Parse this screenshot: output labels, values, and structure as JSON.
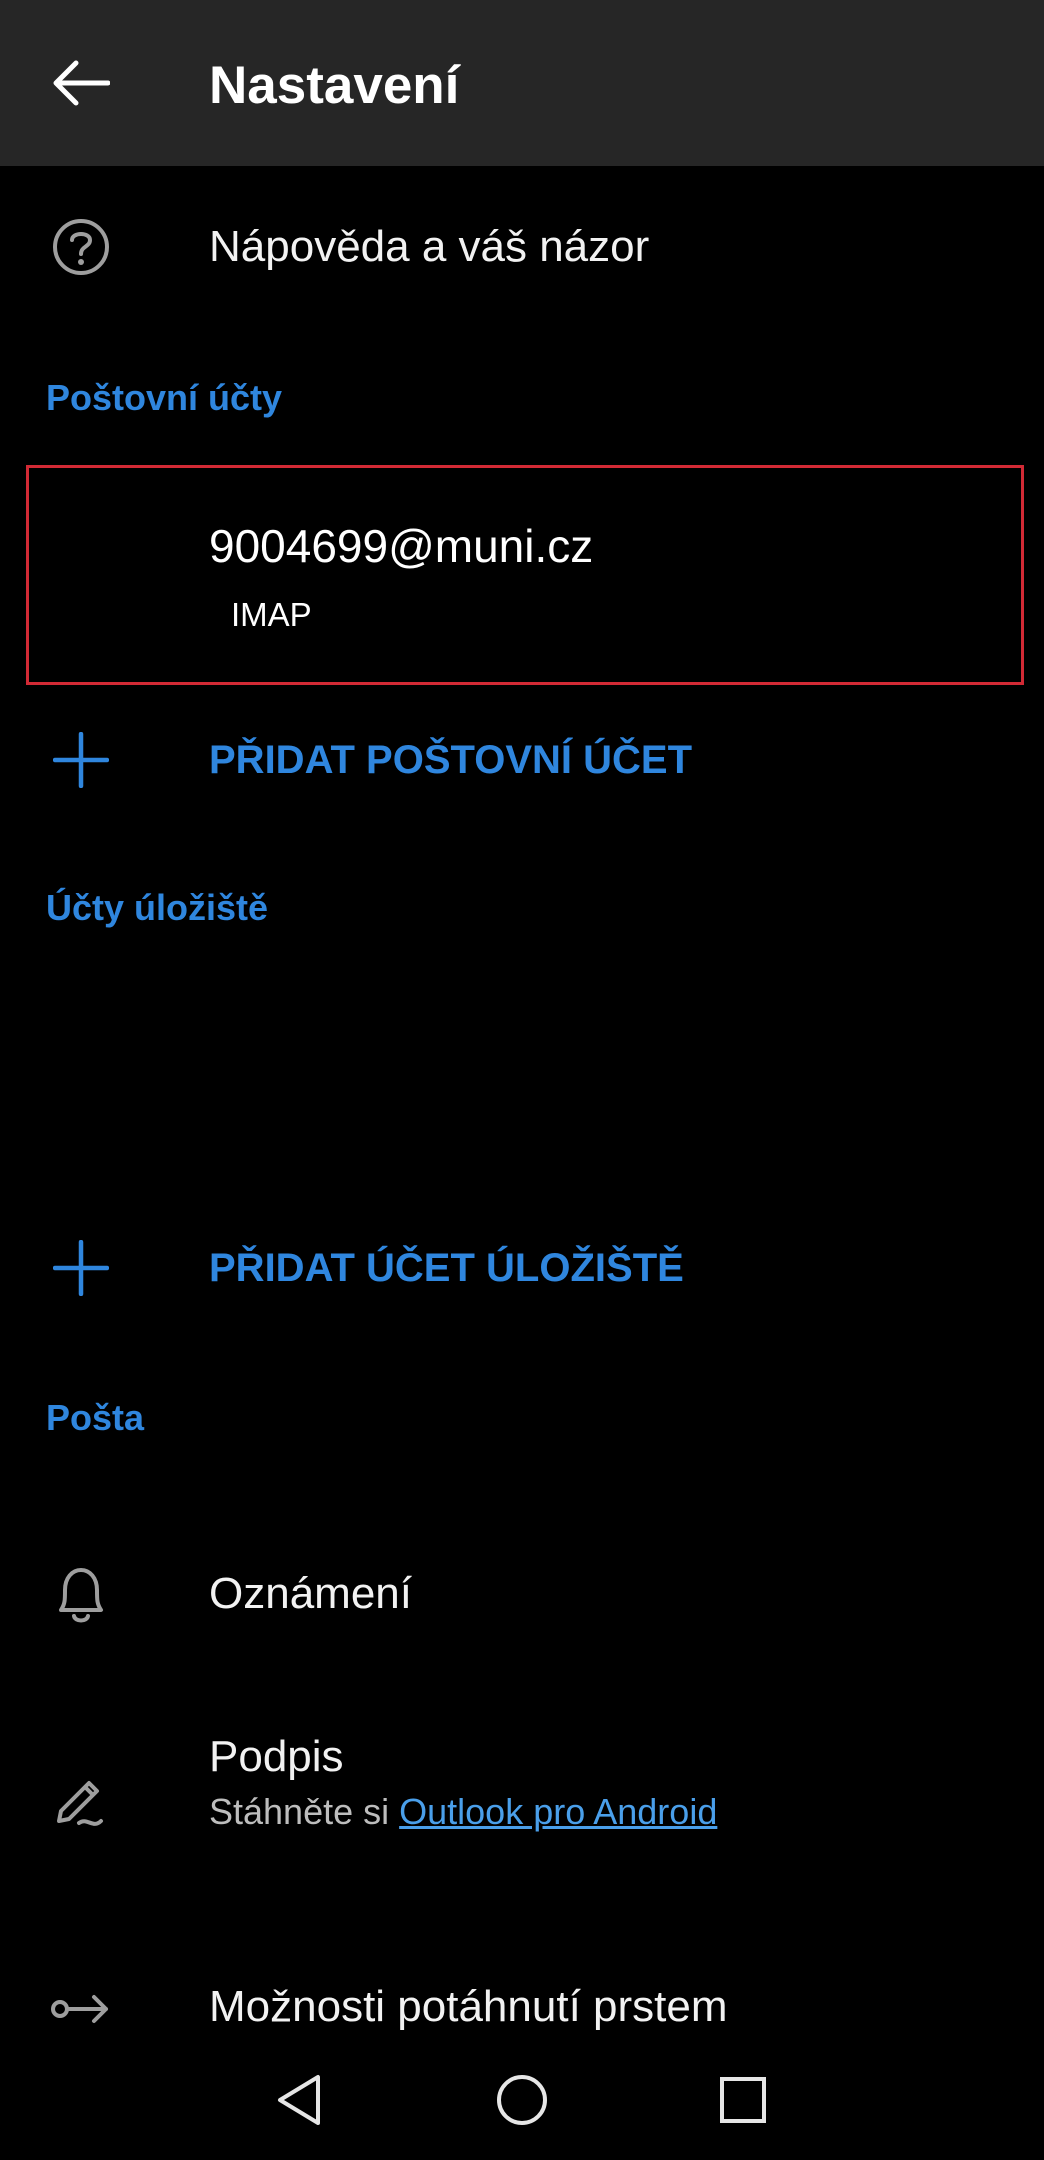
{
  "appbar": {
    "title": "Nastavení"
  },
  "help": {
    "label": "Nápověda a váš názor"
  },
  "mail_accounts": {
    "header": "Poštovní účty",
    "account_email": "9004699@muni.cz",
    "account_type": "IMAP",
    "add_label": "PŘIDAT POŠTOVNÍ ÚČET"
  },
  "storage_accounts": {
    "header": "Účty úložiště",
    "add_label": "PŘIDAT ÚČET ÚLOŽIŠTĚ"
  },
  "mail": {
    "header": "Pošta",
    "notifications_label": "Oznámení",
    "signature_label": "Podpis",
    "signature_sub_prefix": "Stáhněte si",
    "signature_sub_link": "Outlook pro Android",
    "swipe_label": "Možnosti potáhnutí prstem"
  },
  "colors": {
    "accent": "#2f86de",
    "highlight_border": "#d22a35",
    "appbar_bg": "#262626"
  },
  "icons": {
    "back": "arrow-left-icon",
    "help": "question-circle-icon",
    "add": "plus-icon",
    "notifications": "bell-icon",
    "signature": "pen-signature-icon",
    "swipe": "swipe-arrow-icon",
    "nav_back": "triangle-back-icon",
    "nav_home": "circle-home-icon",
    "nav_recents": "square-recents-icon"
  }
}
